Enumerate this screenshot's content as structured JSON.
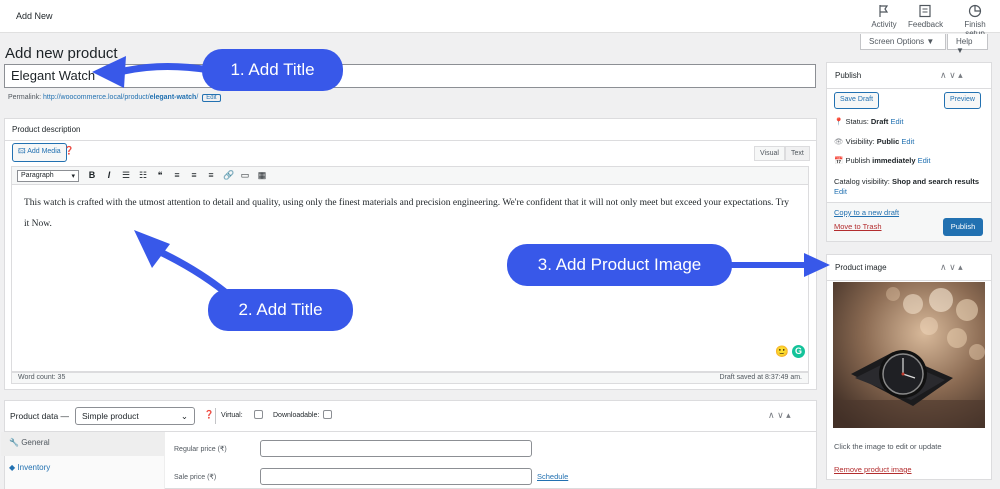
{
  "topbar": {
    "title": "Add New",
    "activity_label": "Activity",
    "feedback_label": "Feedback",
    "finish_label": "Finish setup"
  },
  "screen_options": "Screen Options ▼",
  "help": "Help ▼",
  "page_title": "Add new product",
  "product_title_value": "Elegant Watch",
  "permalink": {
    "label": "Permalink:",
    "url_prefix": "http://woocommerce.local/product/",
    "slug": "elegant-watch",
    "url_suffix": "/",
    "edit": "Edit"
  },
  "description": {
    "header": "Product description",
    "add_media": "Add Media",
    "tab_visual": "Visual",
    "tab_text": "Text",
    "format_select": "Paragraph",
    "body": "This watch is crafted with the utmost attention to detail and quality, using only the finest materials and precision engineering. We're confident that it will not only meet but exceed your expectations.  Try it Now.",
    "word_count": "Word count: 35",
    "draft_saved": "Draft saved at 8:37:49 am."
  },
  "callouts": {
    "one": "1. Add Title",
    "two": "2. Add Title",
    "three": "3. Add Product Image"
  },
  "publish": {
    "header": "Publish",
    "save_draft": "Save Draft",
    "preview": "Preview",
    "status_label": "Status:",
    "status_value": "Draft",
    "visibility_label": "Visibility:",
    "visibility_value": "Public",
    "publish_label": "Publish",
    "publish_value": "immediately",
    "catalog_label": "Catalog visibility:",
    "catalog_value": "Shop and search results",
    "edit": "Edit",
    "copy_draft": "Copy to a new draft",
    "move_trash": "Move to Trash",
    "publish_button": "Publish"
  },
  "product_image": {
    "header": "Product image",
    "hint": "Click the image to edit or update",
    "remove": "Remove product image"
  },
  "product_data": {
    "label": "Product data —",
    "type_select": "Simple product",
    "virtual": "Virtual:",
    "downloadable": "Downloadable:",
    "tabs": [
      "General",
      "Inventory"
    ],
    "regular_price": "Regular price (₹)",
    "sale_price": "Sale price (₹)",
    "schedule": "Schedule"
  },
  "colors": {
    "accent": "#2271b1",
    "callout": "#3858e9",
    "trash": "#b32d2e"
  }
}
